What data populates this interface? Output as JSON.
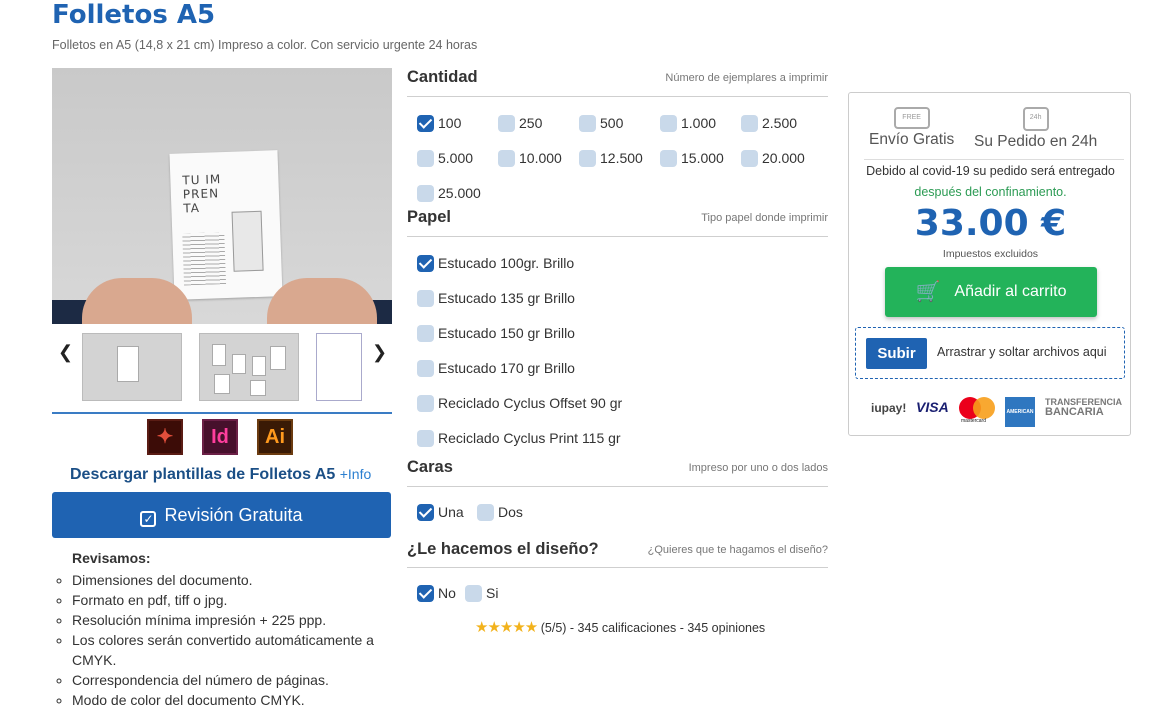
{
  "product": {
    "title": "Folletos A5",
    "subtitle": "Folletos en A5 (14,8 x 21 cm) Impreso a color. Con servicio urgente 24 horas"
  },
  "gallery": {
    "flyer_text": "TU IM PREN TA",
    "prev_icon": "chevron-left-icon",
    "next_icon": "chevron-right-icon"
  },
  "apps": {
    "pdf": "",
    "id": "Id",
    "ai": "Ai"
  },
  "download": {
    "label": "Descargar plantillas de Folletos A5",
    "info": "+Info"
  },
  "review": {
    "button": "Revisión Gratuita",
    "heading": "Revisamos:",
    "items": [
      "Dimensiones del documento.",
      "Formato en pdf, tiff o jpg.",
      "Resolución mínima impresión + 225 ppp.",
      "Los colores serán convertido automáticamente a CMYK.",
      "Correspondencia del número de páginas.",
      "Modo de color del documento CMYK."
    ]
  },
  "quantity": {
    "title": "Cantidad",
    "hint": "Número de ejemplares a imprimir",
    "options": [
      "100",
      "250",
      "500",
      "1.000",
      "2.500",
      "5.000",
      "10.000",
      "12.500",
      "15.000",
      "20.000",
      "25.000"
    ],
    "selected": "100"
  },
  "paper": {
    "title": "Papel",
    "hint": "Tipo papel donde imprimir",
    "options": [
      "Estucado 100gr. Brillo",
      "Estucado 135 gr Brillo",
      "Estucado 150 gr Brillo",
      "Estucado 170 gr Brillo",
      "Reciclado Cyclus Offset 90 gr",
      "Reciclado Cyclus Print 115 gr"
    ],
    "selected": "Estucado 100gr. Brillo"
  },
  "sides": {
    "title": "Caras",
    "hint": "Impreso por uno o dos lados",
    "options": [
      "Una",
      "Dos"
    ],
    "selected": "Una"
  },
  "design": {
    "title": "¿Le hacemos el diseño?",
    "hint": "¿Quieres que te hagamos el diseño?",
    "options": [
      "No",
      "Si"
    ],
    "selected": "No"
  },
  "rating": {
    "stars": "★★★★★",
    "score": "(5/5)",
    "text": "-  345 calificaciones - 345 opiniones"
  },
  "cart": {
    "shipping": "Envío Gratis",
    "shipping_icon_text": "FREE",
    "delivery": "Su Pedido en 24h",
    "delivery_icon_text": "24h",
    "covid_text": "Debido al covid-19 su pedido será entregado",
    "covid_link": "después del confinamiento.",
    "price": "33.00 €",
    "tax_note": "Impuestos excluidos",
    "add_button": "Añadir al carrito",
    "upload_button": "Subir",
    "drop_text": "Arrastrar y soltar archivos aqui"
  },
  "payments": {
    "iupay": "iupay!",
    "visa": "VISA",
    "mastercard": "mastercard",
    "amex": "AMERICAN EXPRESS",
    "transfer_1": "TRANSFERENCIA",
    "transfer_2": "BANCARIA"
  },
  "colors": {
    "brand_blue": "#1f63b2",
    "cart_green": "#23b35a",
    "link_green": "#2c9b54"
  }
}
